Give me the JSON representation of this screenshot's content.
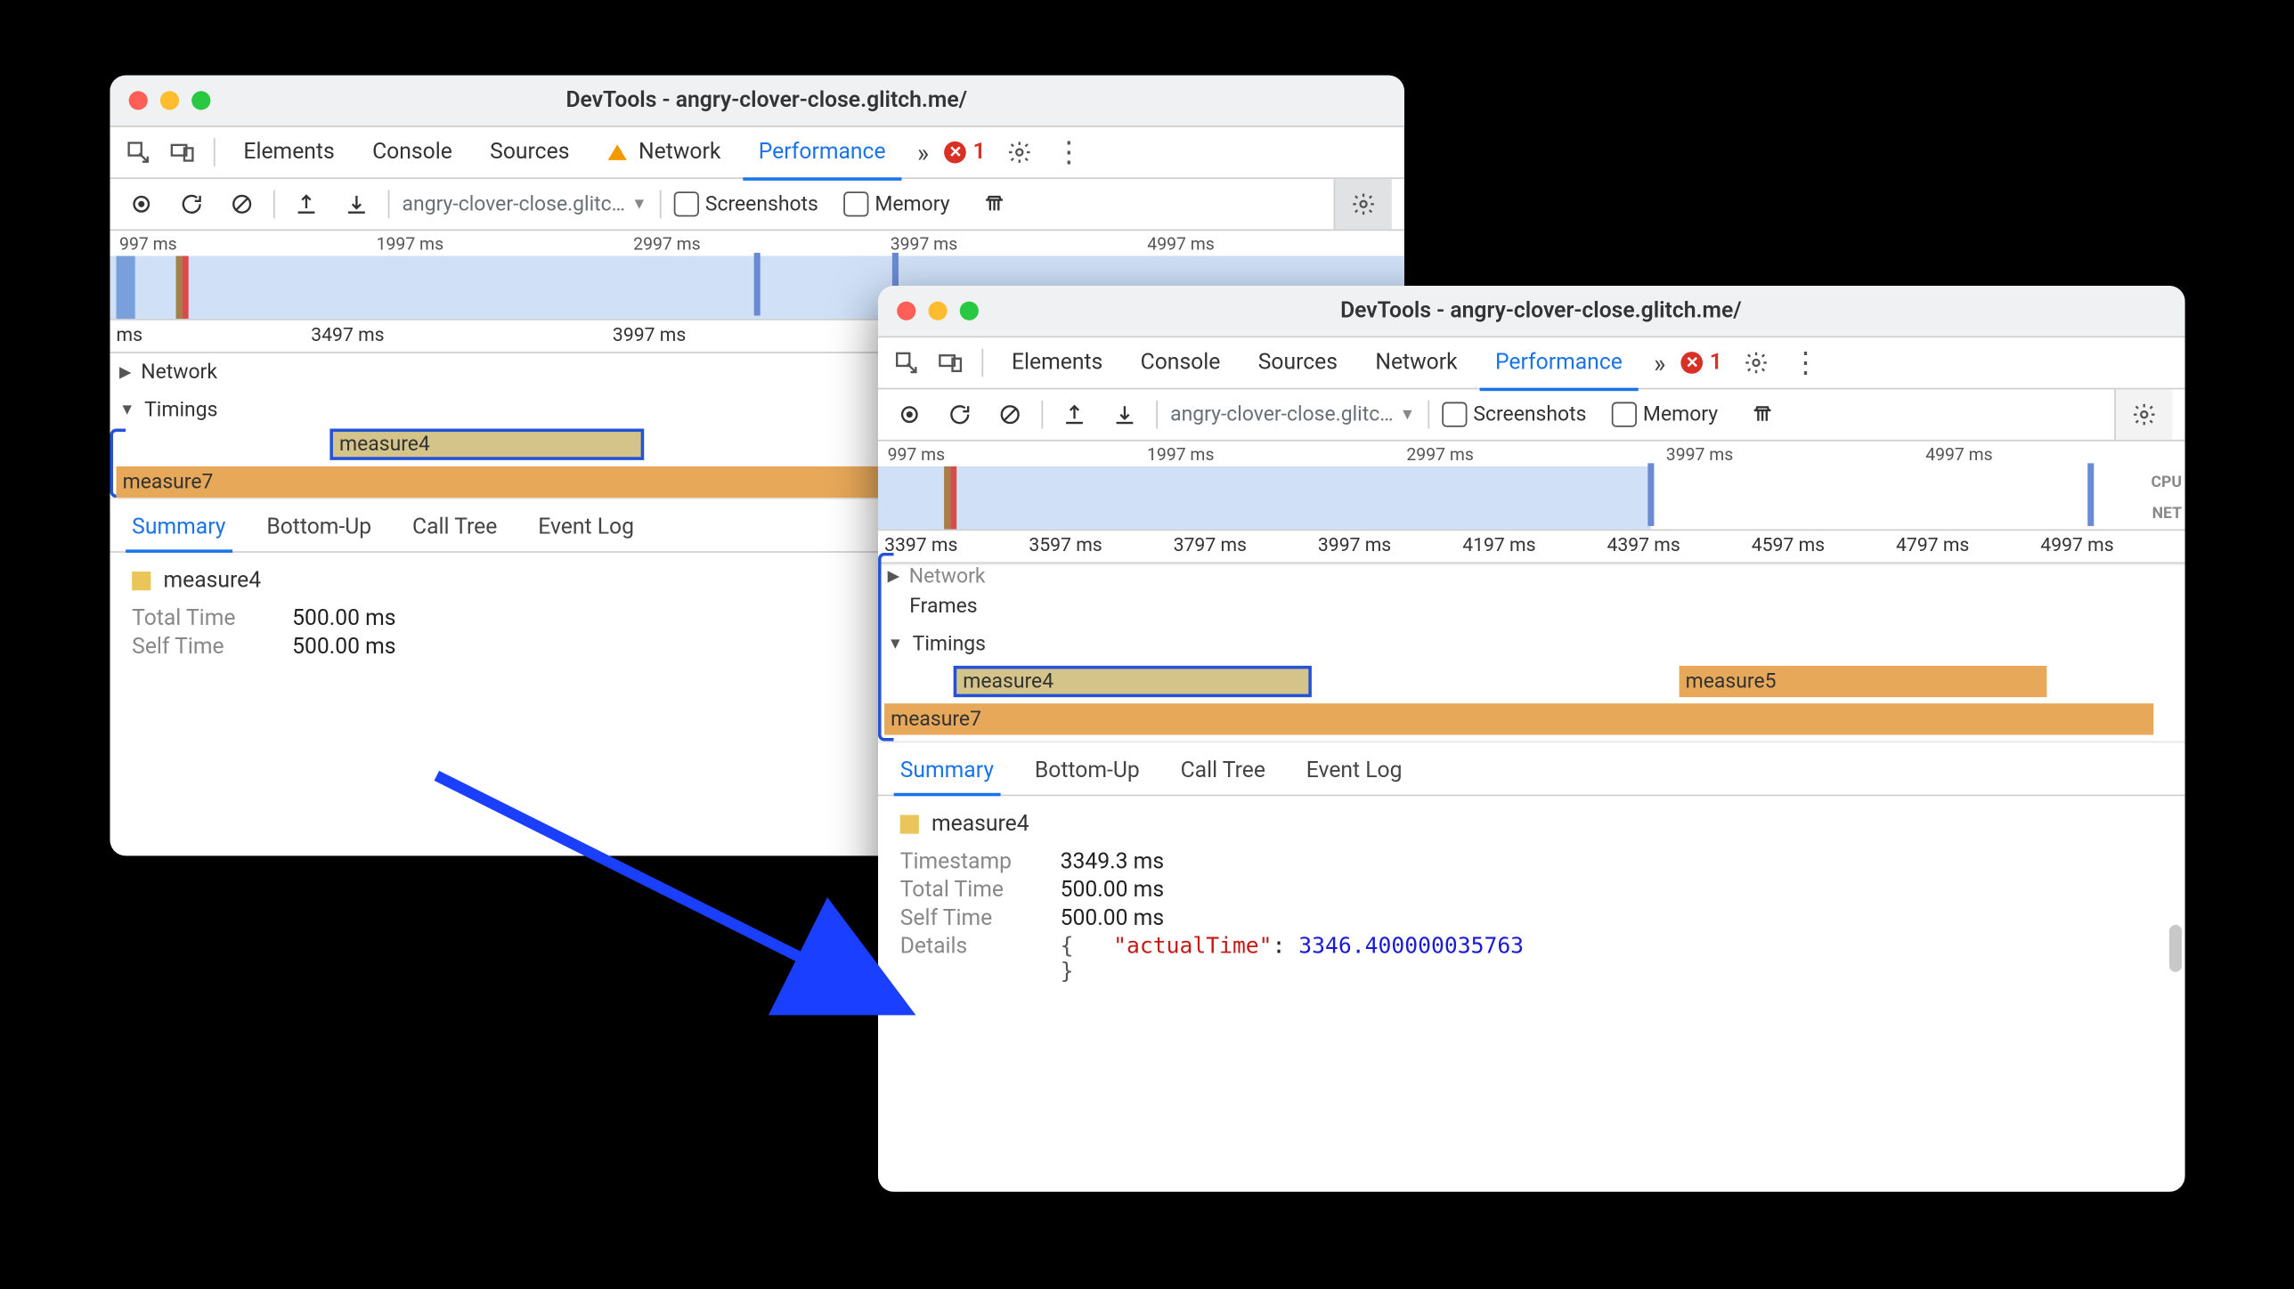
{
  "title_text": "DevTools - angry-clover-close.glitch.me/",
  "tabs": {
    "elements": "Elements",
    "console": "Console",
    "sources": "Sources",
    "network": "Network",
    "performance": "Performance"
  },
  "errcount": "1",
  "toolbar": {
    "url": "angry-clover-close.glitc…",
    "screenshots": "Screenshots",
    "memory": "Memory"
  },
  "win1": {
    "overview_ticks": [
      "997 ms",
      "1997 ms",
      "2997 ms",
      "3997 ms",
      "4997 ms"
    ],
    "ruler": {
      "t0": "ms",
      "t1": "3497 ms",
      "t2": "3997 ms"
    },
    "rows": {
      "network": "Network",
      "timings": "Timings"
    },
    "blocks": {
      "m4": "measure4",
      "m7": "measure7"
    },
    "dtabs": {
      "summary": "Summary",
      "bottomup": "Bottom-Up",
      "calltree": "Call Tree",
      "eventlog": "Event Log"
    },
    "details": {
      "title": "measure4",
      "total_k": "Total Time",
      "total_v": "500.00 ms",
      "self_k": "Self Time",
      "self_v": "500.00 ms"
    }
  },
  "win2": {
    "overview_ticks": [
      "997 ms",
      "1997 ms",
      "2997 ms",
      "3997 ms",
      "4997 ms"
    ],
    "cpunet": {
      "cpu": "CPU",
      "net": "NET"
    },
    "ruler": [
      "3397 ms",
      "3597 ms",
      "3797 ms",
      "3997 ms",
      "4197 ms",
      "4397 ms",
      "4597 ms",
      "4797 ms",
      "4997 ms"
    ],
    "rows": {
      "network": "Network",
      "frames": "Frames",
      "timings": "Timings"
    },
    "blocks": {
      "m4": "measure4",
      "m5": "measure5",
      "m7": "measure7"
    },
    "dtabs": {
      "summary": "Summary",
      "bottomup": "Bottom-Up",
      "calltree": "Call Tree",
      "eventlog": "Event Log"
    },
    "details": {
      "title": "measure4",
      "ts_k": "Timestamp",
      "ts_v": "3349.3 ms",
      "total_k": "Total Time",
      "total_v": "500.00 ms",
      "self_k": "Self Time",
      "self_v": "500.00 ms",
      "det_k": "Details",
      "json_key": "\"actualTime\"",
      "json_val": "3346.400000035763"
    }
  }
}
